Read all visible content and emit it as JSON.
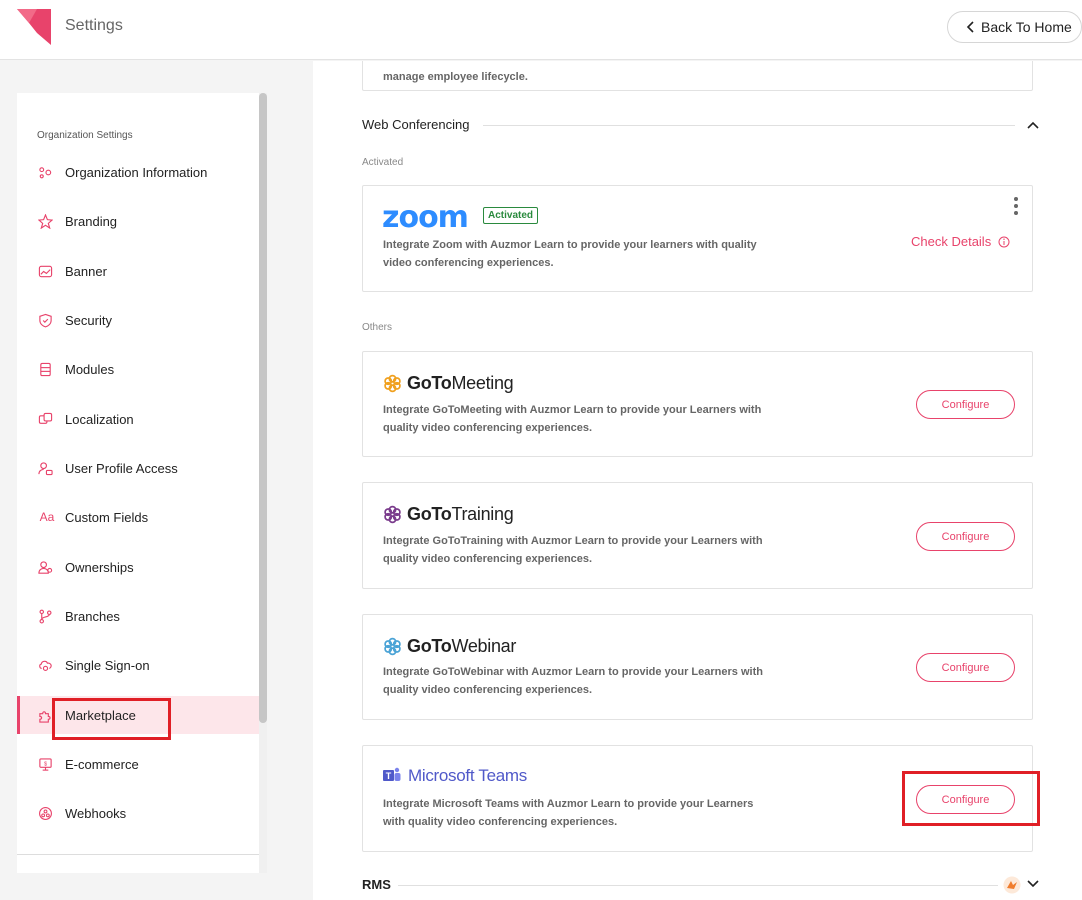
{
  "header": {
    "title": "Settings",
    "back_label": "Back To Home"
  },
  "sidebar": {
    "heading": "Organization Settings",
    "items": [
      {
        "label": "Organization Information",
        "icon": "org-info-icon"
      },
      {
        "label": "Branding",
        "icon": "branding-icon"
      },
      {
        "label": "Banner",
        "icon": "banner-icon"
      },
      {
        "label": "Security",
        "icon": "security-shield-icon"
      },
      {
        "label": "Modules",
        "icon": "modules-icon"
      },
      {
        "label": "Localization",
        "icon": "localization-icon"
      },
      {
        "label": "User Profile Access",
        "icon": "user-profile-icon"
      },
      {
        "label": "Custom Fields",
        "icon": "custom-fields-icon"
      },
      {
        "label": "Ownerships",
        "icon": "ownership-icon"
      },
      {
        "label": "Branches",
        "icon": "branch-icon"
      },
      {
        "label": "Single Sign-on",
        "icon": "sso-icon"
      },
      {
        "label": "Marketplace",
        "icon": "puzzle-icon",
        "active": true
      },
      {
        "label": "E-commerce",
        "icon": "ecommerce-icon"
      },
      {
        "label": "Webhooks",
        "icon": "webhook-icon"
      }
    ],
    "custom_fields_glyph": "Aa"
  },
  "main": {
    "top_card_desc": "manage employee lifecycle.",
    "web_conf_title": "Web Conferencing",
    "activated_label": "Activated",
    "others_label": "Others",
    "zoom": {
      "logo_text": "zoom",
      "badge": "Activated",
      "desc": "Integrate Zoom with Auzmor Learn to provide your learners with quality video conferencing experiences.",
      "check_details": "Check Details"
    },
    "integrations": [
      {
        "brand_bold": "GoTo",
        "brand_rest": "Meeting",
        "desc": "Integrate GoToMeeting with Auzmor Learn to provide your Learners with quality video conferencing experiences.",
        "button": "Configure",
        "color": "#f0a01e"
      },
      {
        "brand_bold": "GoTo",
        "brand_rest": "Training",
        "desc": "Integrate GoToTraining with Auzmor Learn to provide your Learners with quality video conferencing experiences.",
        "button": "Configure",
        "color": "#7a3b8c"
      },
      {
        "brand_bold": "GoTo",
        "brand_rest": "Webinar",
        "desc": "Integrate GoToWebinar with Auzmor Learn to provide your Learners with quality video conferencing experiences.",
        "button": "Configure",
        "color": "#4aa3d6"
      }
    ],
    "teams": {
      "brand": "Microsoft Teams",
      "desc": "Integrate Microsoft Teams with Auzmor Learn to provide your Learners with quality video conferencing experiences.",
      "button": "Configure"
    },
    "rms_title": "RMS"
  },
  "colors": {
    "accent": "#e8436b",
    "active_bg": "#fde6ea",
    "highlight": "#e01f26",
    "zoom_blue": "#2d8cff",
    "activated_green": "#2a8a3e",
    "teams_purple": "#5059c9"
  }
}
